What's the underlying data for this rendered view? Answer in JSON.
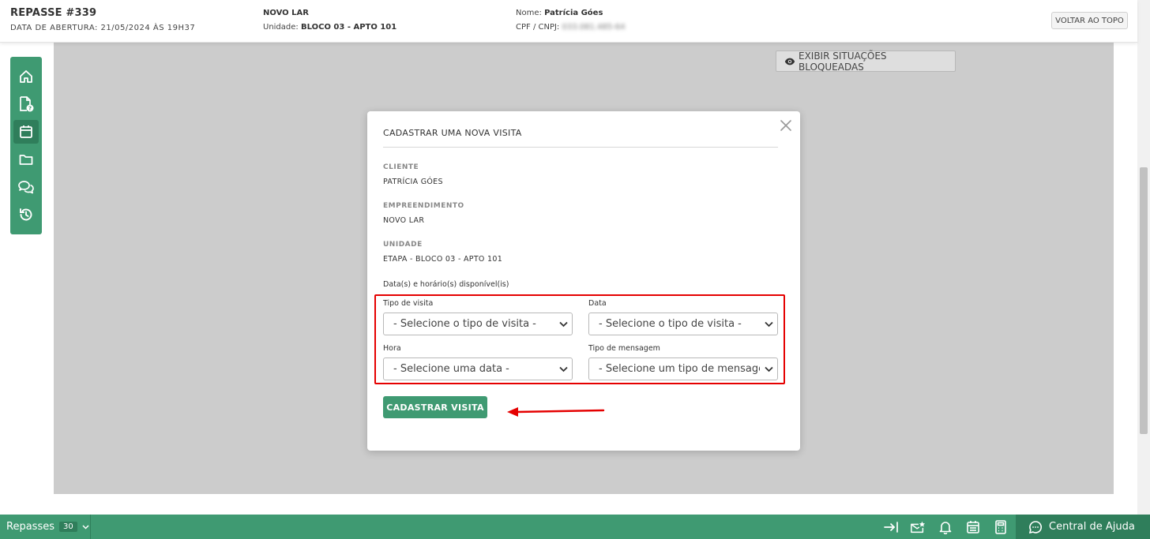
{
  "header": {
    "title": "REPASSE #339",
    "opening_label": "DATA DE ABERTURA: 21/05/2024 ÀS 19H37",
    "project": "NOVO LAR",
    "unit_label": "Unidade:",
    "unit_value": "BLOCO 03 - APTO 101",
    "name_label": "Nome:",
    "name_value": "Patrícia Góes",
    "cpf_label": "CPF / CNPJ:",
    "cpf_value": "033.081.485-64",
    "back_to_top": "VOLTAR AO TOPO"
  },
  "sidenav": {
    "items": [
      {
        "icon": "home-icon"
      },
      {
        "icon": "document-question-icon"
      },
      {
        "icon": "calendar-icon",
        "active": true
      },
      {
        "icon": "folder-icon"
      },
      {
        "icon": "chat-icon"
      },
      {
        "icon": "history-icon"
      }
    ]
  },
  "content": {
    "blocked_button": "EXIBIR SITUAÇÕES BLOQUEADAS"
  },
  "modal": {
    "title": "CADASTRAR UMA NOVA VISITA",
    "client_label": "CLIENTE",
    "client_value": "PATRÍCIA GÓES",
    "project_label": "EMPREENDIMENTO",
    "project_value": "NOVO LAR",
    "unit_label": "UNIDADE",
    "unit_value": "ETAPA - BLOCO 03 - APTO 101",
    "availability_label": "Data(s) e horário(s) disponível(is)",
    "fields": {
      "visit_type": {
        "label": "Tipo de visita",
        "value": "- Selecione o tipo de visita -"
      },
      "date": {
        "label": "Data",
        "value": "- Selecione o tipo de visita -"
      },
      "hour": {
        "label": "Hora",
        "value": "- Selecione uma data -"
      },
      "message_type": {
        "label": "Tipo de mensagem",
        "value": "- Selecione um tipo de mensagem -"
      }
    },
    "submit": "CADASTRAR VISITA"
  },
  "bottombar": {
    "repasses_label": "Repasses",
    "repasses_count": "30",
    "help_label": "Central de Ajuda"
  },
  "colors": {
    "primary_green": "#3f9a72",
    "dark_green": "#2f7e5b",
    "annotation_red": "#e50000",
    "overlay_gray": "#cccccc"
  }
}
